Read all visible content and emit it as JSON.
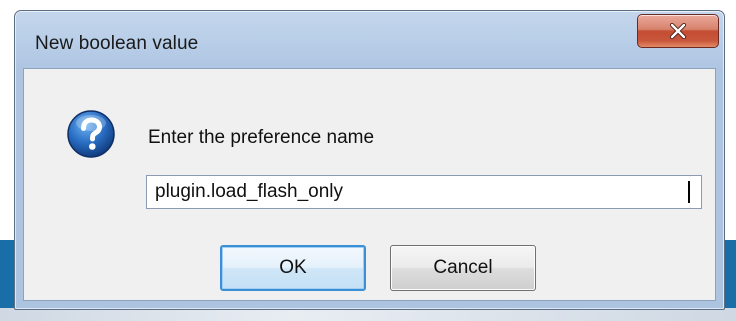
{
  "dialog": {
    "title": "New boolean value",
    "close_icon": "close-x-icon",
    "prompt_icon": "question-help-icon",
    "prompt_label": "Enter the preference name",
    "input_value": "plugin.load_flash_only",
    "ok_label": "OK",
    "cancel_label": "Cancel"
  },
  "colors": {
    "close_button": "#c44d33",
    "help_icon": "#1d5fb0",
    "ok_border": "#3c8ed6",
    "title_bar": "#b5cbe6"
  }
}
